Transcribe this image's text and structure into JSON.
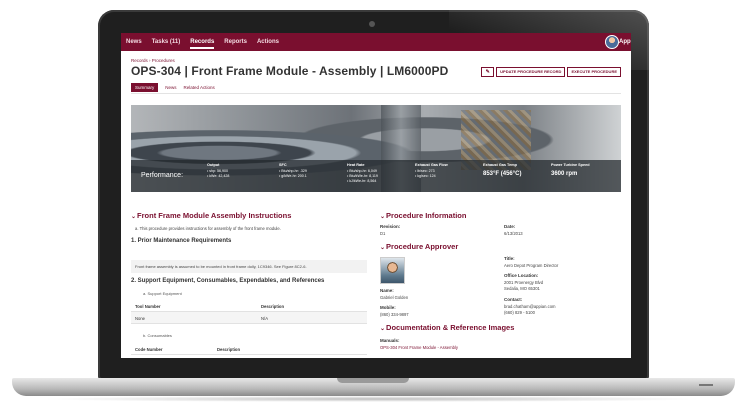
{
  "nav": {
    "items": [
      "News",
      "Tasks (11)",
      "Records",
      "Reports",
      "Actions"
    ],
    "active_index": 2,
    "app_name": "Appian"
  },
  "header": {
    "breadcrumb": "Records › Procedures",
    "title": "OPS-304 | Front Frame Module - Assembly | LM6000PD",
    "update_button": "UPDATE PROCEDURE RECORD",
    "execute_button": "EXECUTE PROCEDURE"
  },
  "tabs": [
    "Summary",
    "News",
    "Related Actions"
  ],
  "banner": {
    "label": "Performance:",
    "metrics": [
      {
        "title": "Output",
        "lines": [
          "• shp: 56,900",
          "• kWe: 42,428"
        ]
      },
      {
        "title": "SFC",
        "lines": [
          "• Btu/shp-hr: .329",
          "• g/kWe-hr: 200.1"
        ]
      },
      {
        "title": "Heat Rate",
        "lines": [
          "• Btu/shp-hr: 6,049",
          "• Btu/kWe-hr: 8,119",
          "• kJ/kWe-hr: 8,564"
        ]
      },
      {
        "title": "Exhaust Gas Flow",
        "lines": [
          "• lb/sec: 273",
          "• kg/sec: 124"
        ]
      },
      {
        "title": "Exhaust Gas Temp",
        "big": "853°F (456°C)"
      },
      {
        "title": "Power Turbine Speed",
        "big": "3600 rpm"
      }
    ]
  },
  "instructions": {
    "heading": "Front Frame Module Assembly Instructions",
    "intro": "a. This procedure provides instructions for assembly of the front frame module.",
    "step1_heading": "1. Prior Maintenance Requirements",
    "step1_note": "Front frame assembly is assumed to be mounted in front frame dolly, 1C9346. See Figure 8C2-6.",
    "step2_heading": "2. Support Equipment, Consumables, Expendables, and References",
    "support_label": "a. Support Equipment",
    "tool_table": {
      "headers": [
        "Tool Number",
        "Description"
      ],
      "rows": [
        [
          "None",
          "N/A"
        ]
      ]
    },
    "consumables_label": "b. Consumables",
    "consumables_headers": [
      "Code Number",
      "Description"
    ]
  },
  "procedure_info": {
    "heading": "Procedure Information",
    "revision_label": "Revision:",
    "revision_value": "D1",
    "date_label": "Date:",
    "date_value": "6/13/2013"
  },
  "approver": {
    "heading": "Procedure Approver",
    "name_label": "Name:",
    "name_value": "Gabriel Golden",
    "mobile_label": "Mobile:",
    "mobile_value": "(860) 334-9897",
    "title_label": "Title:",
    "title_value": "Aero Depot Program Director",
    "office_label": "Office Location:",
    "office_line1": "2001 Proenergy Blvd",
    "office_line2": "Sedalia, MO 65301",
    "contact_label": "Contact:",
    "contact_email": "brad.chatham@appian.com",
    "contact_phone": "(660) 829 - 5100"
  },
  "docs": {
    "heading": "Documentation & Reference Images",
    "manuals_label": "Manuals:",
    "manual_link": "OPS-304 Front Frame Module - Assembly"
  }
}
